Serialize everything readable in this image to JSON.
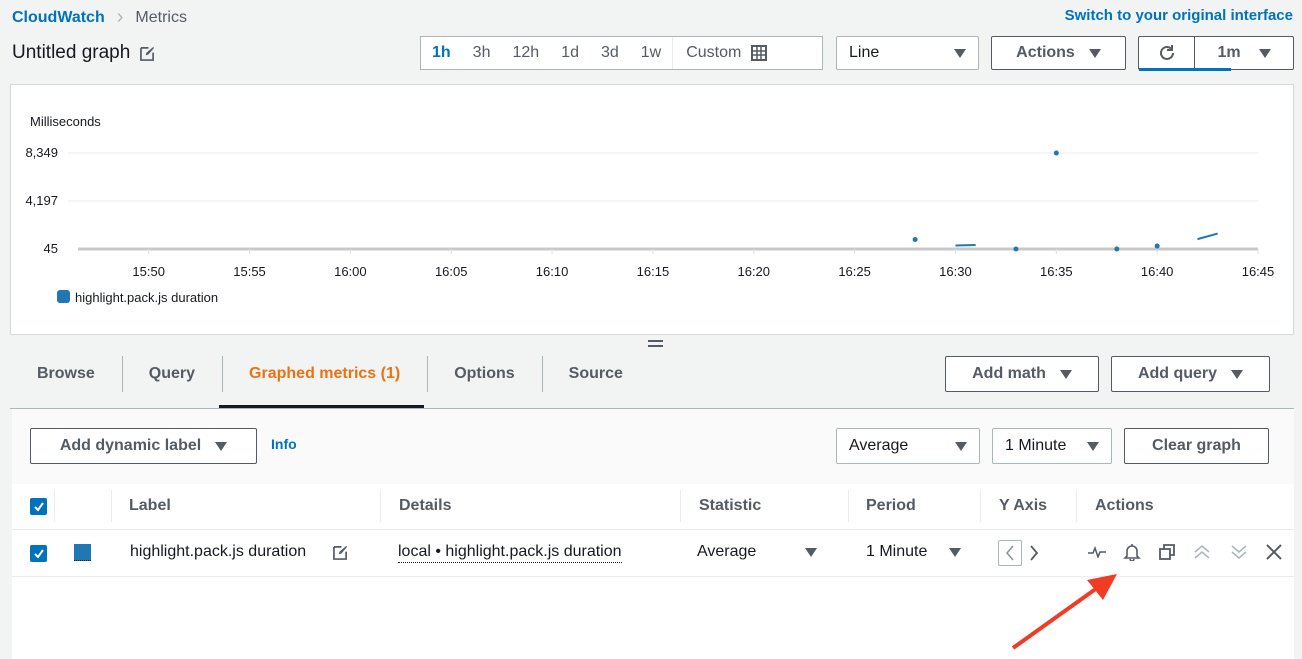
{
  "breadcrumb": {
    "root": "CloudWatch",
    "current": "Metrics"
  },
  "switch_link": "Switch to your original interface",
  "graph_title": "Untitled graph",
  "time_range": {
    "options": [
      "1h",
      "3h",
      "12h",
      "1d",
      "3d",
      "1w"
    ],
    "active": "1h",
    "custom_label": "Custom"
  },
  "chart_type_select": {
    "value": "Line"
  },
  "actions_button": "Actions",
  "refresh": {
    "interval": "1m",
    "progress_fraction": 0.6
  },
  "chart_data": {
    "type": "line",
    "title": "",
    "ylabel": "Milliseconds",
    "xlabel": "",
    "y_ticks": [
      45,
      4197,
      8349
    ],
    "y_tick_labels": [
      "45",
      "4,197",
      "8,349"
    ],
    "ylim": [
      45,
      8349
    ],
    "x_ticks": [
      "15:50",
      "15:55",
      "16:00",
      "16:05",
      "16:10",
      "16:15",
      "16:20",
      "16:25",
      "16:30",
      "16:35",
      "16:40",
      "16:45"
    ],
    "x_range": [
      "15:46",
      "16:45"
    ],
    "grid": true,
    "legend": {
      "position": "bottom-left",
      "entries": [
        {
          "name": "highlight.pack.js duration",
          "color": "#1f77b4"
        }
      ]
    },
    "series": [
      {
        "name": "highlight.pack.js duration",
        "color": "#1f77b4",
        "segments": [
          [
            {
              "x": "16:28",
              "y": 870
            }
          ],
          [
            {
              "x": "16:30",
              "y": 350
            },
            {
              "x": "16:31",
              "y": 390
            }
          ],
          [
            {
              "x": "16:33",
              "y": 45
            }
          ],
          [
            {
              "x": "16:35",
              "y": 8349
            }
          ],
          [
            {
              "x": "16:38",
              "y": 45
            }
          ],
          [
            {
              "x": "16:40",
              "y": 300
            }
          ],
          [
            {
              "x": "16:42",
              "y": 900
            },
            {
              "x": "16:43",
              "y": 1380
            }
          ]
        ]
      }
    ]
  },
  "tabs": [
    {
      "label": "Browse",
      "active": false
    },
    {
      "label": "Query",
      "active": false
    },
    {
      "label": "Graphed metrics (1)",
      "active": true
    },
    {
      "label": "Options",
      "active": false
    },
    {
      "label": "Source",
      "active": false
    }
  ],
  "add_math_button": "Add math",
  "add_query_button": "Add query",
  "add_dynamic_label_button": "Add dynamic label",
  "info_link": "Info",
  "statistic_select": {
    "value": "Average"
  },
  "period_select": {
    "value": "1 Minute"
  },
  "clear_graph_button": "Clear graph",
  "table": {
    "headers": {
      "label": "Label",
      "details": "Details",
      "statistic": "Statistic",
      "period": "Period",
      "y_axis": "Y Axis",
      "actions": "Actions"
    },
    "rows": [
      {
        "checked": true,
        "color": "#1f77b4",
        "label": "highlight.pack.js duration",
        "details": "local • highlight.pack.js duration",
        "statistic": "Average",
        "period": "1 Minute",
        "y_axis": "left",
        "actions": [
          "graph-only-this-icon",
          "create-alarm-bell-icon",
          "duplicate-icon",
          "move-up-icon",
          "move-down-icon",
          "remove-icon"
        ]
      }
    ]
  },
  "annotation": {
    "type": "red-arrow",
    "points_to": "create-alarm-bell-icon",
    "color": "#f03c24"
  }
}
